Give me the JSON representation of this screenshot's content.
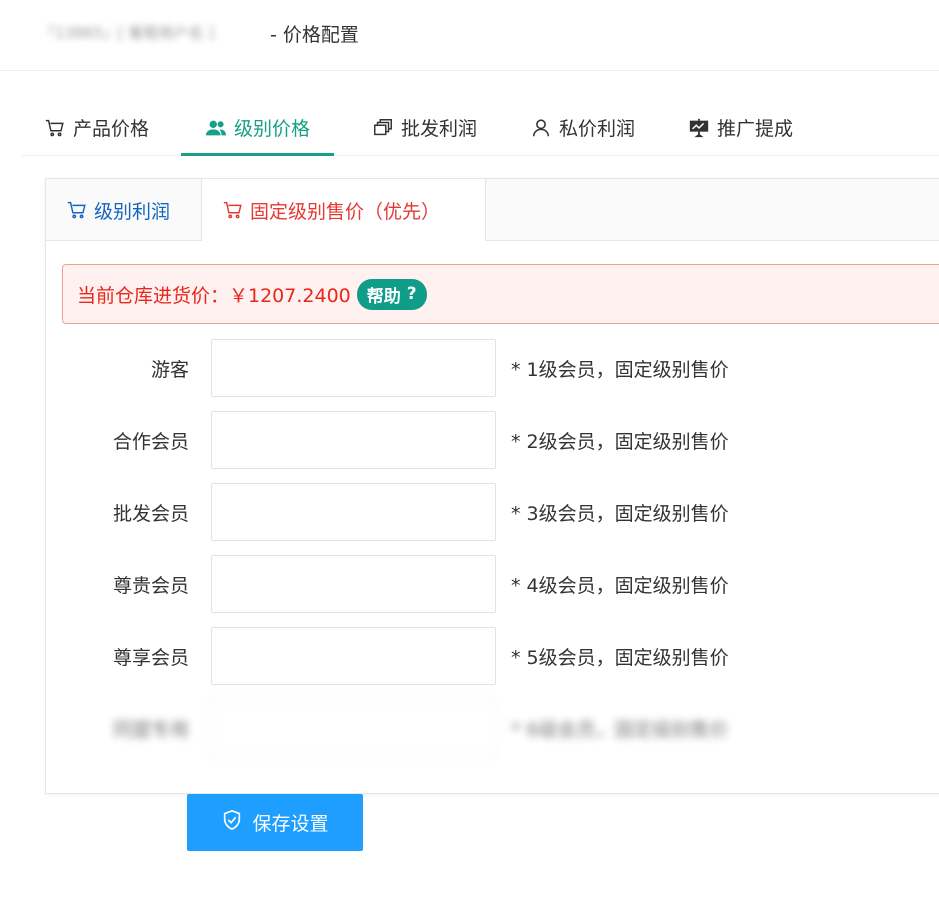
{
  "header": {
    "blurred_title": "「13865」[ 葡萄用户名 ]",
    "title": "- 价格配置"
  },
  "tabs": [
    {
      "label": "产品价格",
      "icon": "cart-icon",
      "active": false
    },
    {
      "label": "级别价格",
      "icon": "users-icon",
      "active": true
    },
    {
      "label": "批发利润",
      "icon": "boxes-icon",
      "active": false
    },
    {
      "label": "私价利润",
      "icon": "user-icon",
      "active": false
    },
    {
      "label": "推广提成",
      "icon": "presentation-icon",
      "active": false
    }
  ],
  "subtabs": [
    {
      "label": "级别利润",
      "icon": "cart-icon",
      "color": "#1565c0"
    },
    {
      "label": "固定级别售价（优先）",
      "icon": "cart-icon",
      "color": "#e53935",
      "active": true
    }
  ],
  "alert": {
    "text": "当前仓库进货价：￥1207.2400",
    "help_label": "帮助",
    "help_icon": "question-icon"
  },
  "form": {
    "rows": [
      {
        "label": "游客",
        "value": "",
        "hint": "* 1级会员，固定级别售价"
      },
      {
        "label": "合作会员",
        "value": "",
        "hint": "* 2级会员，固定级别售价"
      },
      {
        "label": "批发会员",
        "value": "",
        "hint": "* 3级会员，固定级别售价"
      },
      {
        "label": "尊贵会员",
        "value": "",
        "hint": "* 4级会员，固定级别售价"
      },
      {
        "label": "尊享会员",
        "value": "",
        "hint": "* 5级会员，固定级别售价"
      },
      {
        "label": "同盟专用",
        "value": "",
        "hint": "* 6级会员，固定级别售价",
        "blurred": true
      }
    ]
  },
  "save_button": {
    "label": "保存设置",
    "icon": "shield-check-icon"
  },
  "colors": {
    "accent": "#16a085",
    "blue": "#1565c0",
    "red": "#e53935",
    "button": "#1e9fff",
    "help": "#0f9d8a"
  }
}
